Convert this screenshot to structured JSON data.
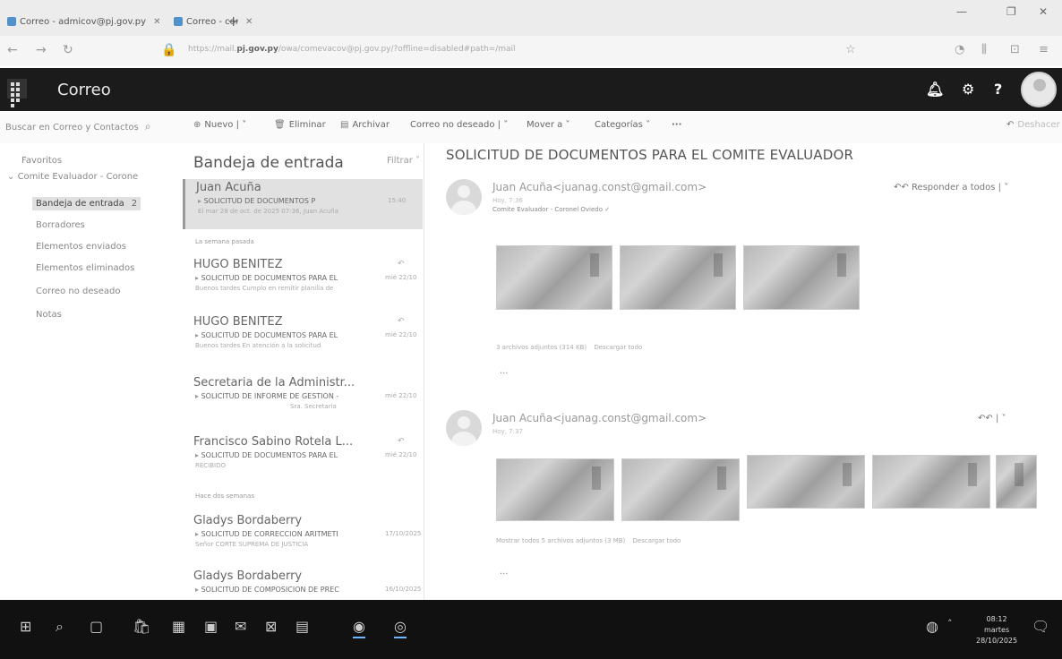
{
  "browser": {
    "tabs": [
      {
        "title": "Correo - admicov@pj.gov.py"
      },
      {
        "title": "Correo - comevacov@pj.gov.py"
      }
    ],
    "url_prefix": "https://mail.",
    "url_domain": "pj.gov.py",
    "url_rest": "/owa/comevacov@pj.gov.py/?offline=disabled#path=/mail"
  },
  "owa": {
    "app_title": "Correo",
    "search_placeholder": "Buscar en Correo y Contactos",
    "commands": {
      "new": "Nuevo",
      "delete": "Eliminar",
      "archive": "Archivar",
      "junk": "Correo no deseado",
      "move": "Mover a",
      "categories": "Categorías",
      "more": "···",
      "undo": "Deshacer"
    }
  },
  "folders": {
    "favorites": "Favoritos",
    "account": "Comite Evaluador - Corone",
    "items": [
      {
        "label": "Bandeja de entrada",
        "count": "2"
      },
      {
        "label": "Borradores",
        "count": ""
      },
      {
        "label": "Elementos enviados",
        "count": ""
      },
      {
        "label": "Elementos eliminados",
        "count": ""
      },
      {
        "label": "Correo no deseado",
        "count": ""
      },
      {
        "label": "Notas",
        "count": ""
      }
    ]
  },
  "message_list": {
    "title": "Bandeja de entrada",
    "filter": "Filtrar",
    "groups": [
      "La semana pasada",
      "Hace dos semanas"
    ],
    "messages": [
      {
        "from": "Juan Acuña",
        "subject": "SOLICITUD DE DOCUMENTOS P",
        "date": "15:40",
        "preview": "El mar 28 de oct. de 2025 07:36, Juan Acuña"
      },
      {
        "from": "HUGO BENITEZ",
        "subject": "SOLICITUD DE DOCUMENTOS PARA EL",
        "date": "mié 22/10",
        "preview": "Buenos tardes Cumplo en remitir planilla de"
      },
      {
        "from": "HUGO BENITEZ",
        "subject": "SOLICITUD DE DOCUMENTOS PARA EL",
        "date": "mié 22/10",
        "preview": "Buenos tardes En atención a la solicitud"
      },
      {
        "from": "Secretaria de la Administr...",
        "subject": "SOLICITUD DE INFORME DE GESTION -",
        "date": "mié 22/10",
        "preview": "Sra. Secretaria"
      },
      {
        "from": "Francisco Sabino Rotela L...",
        "subject": "SOLICITUD DE DOCUMENTOS PARA EL",
        "date": "mié 22/10",
        "preview": "RECIBIDO"
      },
      {
        "from": "Gladys Bordaberry",
        "subject": "SOLICITUD DE CORRECCION ARITMETI",
        "date": "17/10/2025",
        "preview": "Señor CORTE SUPREMA DE JUSTICIA"
      },
      {
        "from": "Gladys Bordaberry",
        "subject": "SOLICITUD DE COMPOSICION DE PREC",
        "date": "16/10/2025",
        "preview": ""
      }
    ]
  },
  "reading": {
    "subject": "SOLICITUD DE DOCUMENTOS PARA EL COMITE EVALUADOR",
    "reply_all": "Responder a todos",
    "emails": [
      {
        "sender": "Juan Acuña<juanag.const@gmail.com>",
        "time": "Hoy, 7:36",
        "to": "Comite Evaluador - Coronel Oviedo",
        "attachments_text": "3 archivos adjuntos (314 KB)",
        "download": "Descargar todo"
      },
      {
        "sender": "Juan Acuña<juanag.const@gmail.com>",
        "time": "Hoy, 7:37",
        "attachments_text": "Mostrar todos 5 archivos adjuntos (3 MB)",
        "download": "Descargar todo"
      }
    ]
  },
  "taskbar": {
    "time": "08:12",
    "day": "martes",
    "date": "28/10/2025"
  }
}
